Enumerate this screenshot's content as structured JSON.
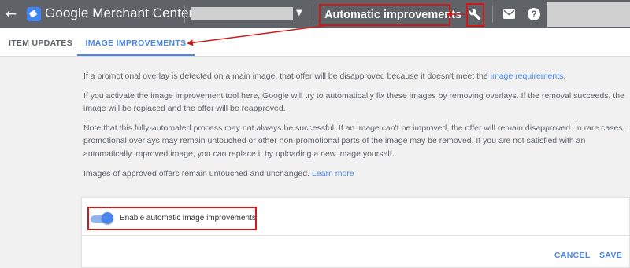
{
  "header": {
    "back_icon": "arrow-back-icon",
    "app_name": "Google Merchant Center",
    "page_title": "Automatic improvements",
    "tools_icon": "wrench-icon",
    "notifications_icon": "mail-icon",
    "help_icon": "help-icon",
    "help_glyph": "?"
  },
  "tabs": [
    {
      "label": "ITEM UPDATES",
      "active": false
    },
    {
      "label": "IMAGE IMPROVEMENTS",
      "active": true
    }
  ],
  "content": {
    "p1_text": "If a promotional overlay is detected on a main image, that offer will be disapproved because it doesn't meet the ",
    "p1_link": "image requirements",
    "p1_end": ".",
    "p2_text": "If you activate the image improvement tool here, Google will try to automatically fix these images by removing overlays. If the removal succeeds, the image will be replaced and the offer will be reapproved.",
    "p3_text": "Note that this fully-automated process may not always be successful. If an image can't be improved, the offer will remain disapproved. In rare cases, promotional overlays may remain untouched or other non-promotional parts of the image may be removed. If you are not satisfied with an automatically improved image, you can replace it by uploading a new image yourself.",
    "p4_text": "Images of approved offers remain untouched and unchanged. ",
    "p4_link": "Learn more"
  },
  "card": {
    "toggle_label": "Enable automatic image improvements",
    "toggle_on": true,
    "cancel_label": "CANCEL",
    "save_label": "SAVE"
  },
  "colors": {
    "topbar": "#5f6368",
    "accent": "#4a86e8",
    "annotation": "#cc1a1a"
  }
}
